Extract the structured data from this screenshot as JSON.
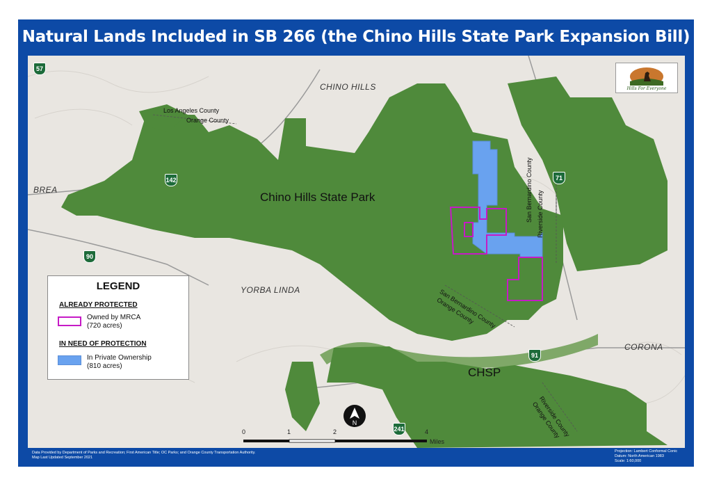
{
  "title": "Natural Lands Included in SB 266 (the Chino Hills State Park Expansion Bill)",
  "map_labels": {
    "chino_hills": "CHINO HILLS",
    "brea": "BREA",
    "yorba_linda": "YORBA LINDA",
    "corona": "CORONA",
    "chino_hills_state_park": "Chino Hills State Park",
    "chsp": "CHSP",
    "la_county": "Los Angeles County",
    "orange_county_top": "Orange County",
    "san_bernardino_county_vert": "San Bernardino County",
    "riverside_county_vert": "Riverside County",
    "sb_county_diag": "San Bernardino County",
    "orange_county_diag": "Orange County",
    "riverside_county_diag": "Riverside County",
    "orange_county_diag2": "Orange County"
  },
  "route_shields": [
    "57",
    "142",
    "90",
    "71",
    "91",
    "241"
  ],
  "logo_text": "Hills For Everyone",
  "legend": {
    "title": "LEGEND",
    "protected_heading": "ALREADY PROTECTED",
    "mrca_label": "Owned by MRCA",
    "mrca_acres": "(720 acres)",
    "need_heading": "IN NEED OF PROTECTION",
    "private_label": "In Private Ownership",
    "private_acres": "(810 acres)"
  },
  "scale_bar": {
    "ticks": [
      "0",
      "1",
      "2",
      "4"
    ],
    "unit": "Miles"
  },
  "north_arrow": "N",
  "footer": {
    "source_line1": "Data Provided by Department of Parks and Recreation; First American Title; OC Parks; and Orange County Transportation Authority.",
    "source_line2": "Map Last Updated September 2021",
    "projection": "Projection: Lambert Conformal Conic",
    "datum": "Datum: North American 1983",
    "scale": "Scale: 1:60,000"
  },
  "colors": {
    "frame": "#0d4aa6",
    "park_green": "#4f8a3b",
    "mrca_outline": "#c61ac6",
    "private_blue": "#69a2ef",
    "background": "#e9e6e1"
  }
}
